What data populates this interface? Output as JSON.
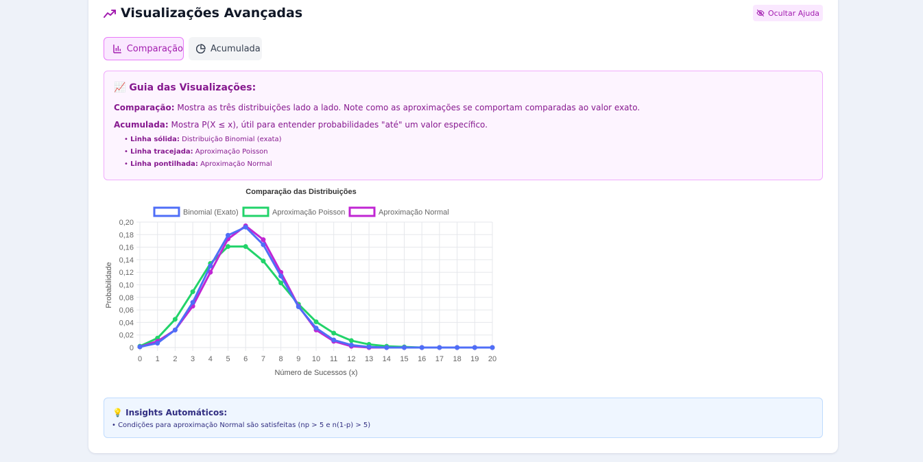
{
  "header": {
    "title": "Visualizações Avançadas",
    "hide_help_label": "Ocultar Ajuda"
  },
  "tabs": [
    {
      "label": "Comparação",
      "active": true,
      "icon": "bar-chart-icon"
    },
    {
      "label": "Acumulada",
      "active": false,
      "icon": "pie-chart-icon"
    }
  ],
  "guide": {
    "emoji": "📈",
    "title": "Guia das Visualizações:",
    "comparison_label": "Comparação:",
    "comparison_text": "Mostra as três distribuições lado a lado. Note como as aproximações se comportam comparadas ao valor exato.",
    "cumulative_label": "Acumulada:",
    "cumulative_text": "Mostra P(X ≤ x), útil para entender probabilidades \"até\" um valor específico.",
    "bullets": [
      {
        "label": "Linha sólida:",
        "text": "Distribuição Binomial (exata)"
      },
      {
        "label": "Linha tracejada:",
        "text": "Aproximação Poisson"
      },
      {
        "label": "Linha pontilhada:",
        "text": "Aproximação Normal"
      }
    ]
  },
  "chart_data": {
    "type": "line",
    "title": "Comparação das Distribuições",
    "xlabel": "Número de Sucessos (x)",
    "ylabel": "Probabilidade",
    "x": [
      0,
      1,
      2,
      3,
      4,
      5,
      6,
      7,
      8,
      9,
      10,
      11,
      12,
      13,
      14,
      15,
      16,
      17,
      18,
      19,
      20
    ],
    "ylim": [
      0,
      0.2
    ],
    "yticks": [
      "0",
      "0,02",
      "0,04",
      "0,06",
      "0,08",
      "0,10",
      "0,12",
      "0,14",
      "0,16",
      "0,18",
      "0,20"
    ],
    "grid": true,
    "legend_position": "top",
    "series": [
      {
        "name": "Binomial (Exato)",
        "color": "#4f6ef7",
        "values": [
          0.001,
          0.007,
          0.028,
          0.072,
          0.13,
          0.179,
          0.192,
          0.164,
          0.114,
          0.065,
          0.031,
          0.012,
          0.004,
          0.001,
          0.0,
          0.0,
          0.0,
          0.0,
          0.0,
          0.0,
          0.0
        ]
      },
      {
        "name": "Aproximação Poisson",
        "color": "#22d36a",
        "values": [
          0.002,
          0.015,
          0.045,
          0.089,
          0.134,
          0.161,
          0.161,
          0.138,
          0.103,
          0.069,
          0.041,
          0.023,
          0.011,
          0.005,
          0.002,
          0.001,
          0.0,
          0.0,
          0.0,
          0.0,
          0.0
        ]
      },
      {
        "name": "Aproximação Normal",
        "color": "#c026d3",
        "values": [
          0.001,
          0.01,
          0.028,
          0.066,
          0.12,
          0.173,
          0.194,
          0.172,
          0.12,
          0.066,
          0.028,
          0.01,
          0.002,
          0.0,
          0.0,
          0.0,
          0.0,
          0.0,
          0.0,
          0.0,
          0.0
        ]
      }
    ]
  },
  "insights": {
    "emoji": "💡",
    "title": "Insights Automáticos:",
    "items": [
      "• Condições para aproximação Normal são satisfeitas (np > 5 e n(1-p) > 5)"
    ]
  }
}
